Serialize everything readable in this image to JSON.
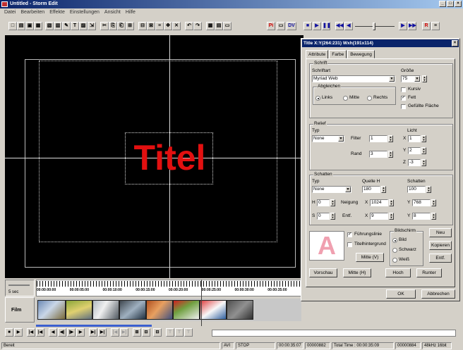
{
  "window": {
    "title": "Untitled - Storm Edit",
    "min": "_",
    "restore": "□",
    "close": "×"
  },
  "menu": [
    "Datei",
    "Bearbeiten",
    "Effekte",
    "Einstellungen",
    "Ansicht",
    "Hilfe"
  ],
  "toolbar": {
    "left_icons": [
      "new-icon",
      "open-icon",
      "save-icon",
      "print-icon",
      "import-icon",
      "bars-icon",
      "tools-icon",
      "text-icon",
      "image-icon",
      "export-icon",
      "cut-icon",
      "copy-icon",
      "paste-icon",
      "split-icon",
      "group-icon",
      "ungroup-icon",
      "align-icon",
      "move-icon",
      "delete-icon",
      "undo-icon",
      "redo-icon",
      "grid-icon",
      "layer-icon",
      "frame-icon"
    ],
    "pi_label": "Pi",
    "dv_label": "DV",
    "r_label": "R"
  },
  "preview": {
    "title_text": "Titel"
  },
  "timeline": {
    "zoom_label": "5 sec",
    "ticks": [
      "00:00:00:00",
      "00:00:05:00",
      "00:00:10:00",
      "00:00:15:00",
      "00:00:20:00",
      "00:00:25:00",
      "00:00:30:00",
      "00:00:35:00"
    ],
    "film_label": "Film"
  },
  "status": {
    "left": "Bereit",
    "format": "AVI",
    "state": "STOP",
    "timecode": "00:00:35:07",
    "frame": "00000882",
    "total": "Total Time : 00:00:35:09",
    "frames": "00000884",
    "audio": "48kHz 16bit"
  },
  "dialog": {
    "title": "Title  X:Y(264:231) Wxh(191x114)",
    "close": "×",
    "tabs": [
      "Attribute",
      "Farbe",
      "Bewegung"
    ],
    "schrift": {
      "group": "Schrift",
      "schriftart_label": "Schriftart",
      "schriftart_value": "Myriad Web",
      "groesse_label": "Größe",
      "groesse_value": "75",
      "abgleichen": "Abgleichen",
      "links": "Links",
      "mitte": "Mitte",
      "rechts": "Rechts",
      "kursiv": "Kursiv",
      "fett": "Fett",
      "gefuellte": "Gefüllte Fläche"
    },
    "relief": {
      "group": "Relief",
      "typ_label": "Typ",
      "typ_value": "None",
      "licht_label": "Licht",
      "filter_label": "Filter",
      "filter_value": "1",
      "rand_label": "Rand",
      "rand_value": "3",
      "x_label": "X",
      "x_value": "1",
      "y_label": "Y",
      "y_value": "2",
      "z_label": "Z",
      "z_value": "-3"
    },
    "schatten": {
      "group": "Schatten",
      "typ_label": "Typ",
      "typ_value": "None",
      "quelle_label": "Quelle H",
      "quelle_value": "180",
      "schatten_label": "Schatten",
      "schatten_value": "100",
      "h_label": "H",
      "h_value": "0",
      "neigung_label": "Neigung",
      "nx_label": "X",
      "nx_value": "1024",
      "ny_label": "Y",
      "ny_value": "768",
      "s_label": "S",
      "s_value": "0",
      "entf_label": "Entf.",
      "ex_label": "X",
      "ex_value": "9",
      "ey_label": "Y",
      "ey_value": "8"
    },
    "misc": {
      "fuehrungslinie": "Führungslinie",
      "titelhintergrund": "Titelhintergrund",
      "mitte_v": "Mitte (V)",
      "mitte_h": "Mitte (H)",
      "vorschau": "Vorschau",
      "bildschirm": "Bildschirm",
      "bild": "Bild",
      "schwarz": "Schwarz",
      "weiss": "Weiß",
      "hoch": "Hoch",
      "runter": "Runter",
      "neu": "Neu",
      "kopieren": "Kopieren",
      "entf": "Entf.",
      "swatch": "A"
    },
    "ok": "OK",
    "abbrechen": "Abbrechen"
  }
}
